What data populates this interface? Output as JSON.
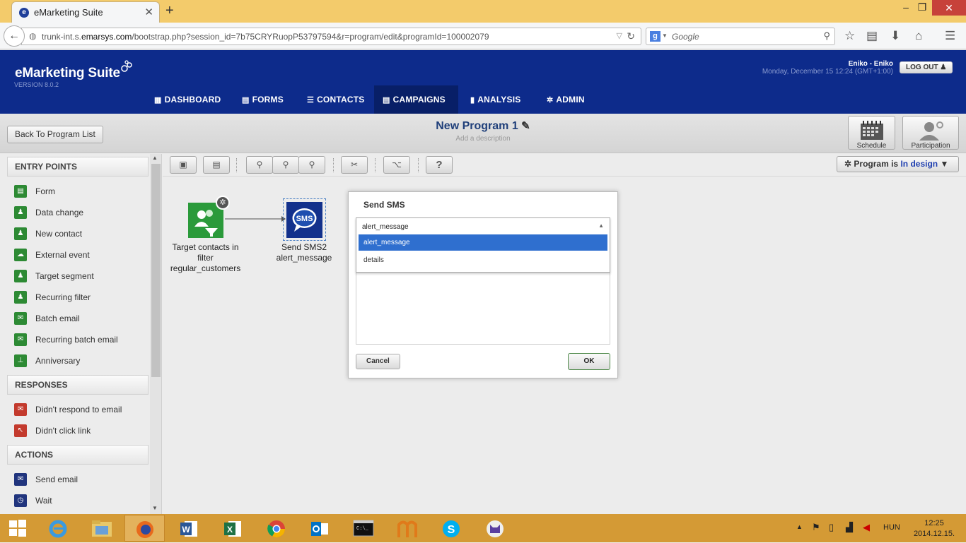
{
  "browser": {
    "tab_title": "eMarketing Suite",
    "url_prefix": "trunk-int.s.",
    "url_domain": "emarsys.com",
    "url_rest": "/bootstrap.php?session_id=7b75CRYRuopP53797594&r=program/edit&programId=100002079",
    "search_placeholder": "Google"
  },
  "app": {
    "logo": "eMarketing Suite",
    "version": "VERSION 8.0.2",
    "user": "Eniko - Eniko",
    "datetime": "Monday, December 15 12:24 (GMT+1:00)",
    "logout": "LOG OUT",
    "menu": [
      {
        "label": "DASHBOARD",
        "icon": "dashboard-icon"
      },
      {
        "label": "FORMS",
        "icon": "forms-icon"
      },
      {
        "label": "CONTACTS",
        "icon": "contacts-icon"
      },
      {
        "label": "CAMPAIGNS",
        "icon": "campaigns-icon",
        "active": true
      },
      {
        "label": "ANALYSIS",
        "icon": "analysis-icon"
      },
      {
        "label": "ADMIN",
        "icon": "gear-icon"
      }
    ]
  },
  "program": {
    "back_button": "Back To Program List",
    "title": "New Program 1",
    "description": "Add a description",
    "schedule": "Schedule",
    "participation": "Participation",
    "status_prefix": "Program is",
    "status_value": "In design"
  },
  "sidebar": {
    "sections": [
      {
        "title": "ENTRY POINTS",
        "items": [
          "Form",
          "Data change",
          "New contact",
          "External event",
          "Target segment",
          "Recurring filter",
          "Batch email",
          "Recurring batch email",
          "Anniversary"
        ]
      },
      {
        "title": "RESPONSES",
        "items": [
          "Didn't respond to email",
          "Didn't click link"
        ]
      },
      {
        "title": "ACTIONS",
        "items": [
          "Send email",
          "Wait"
        ]
      }
    ]
  },
  "canvas": {
    "node1": {
      "line1": "Target contacts in",
      "line2": "filter",
      "line3": "regular_customers"
    },
    "node2": {
      "line1": "Send SMS2",
      "line2": "alert_message",
      "icon_label": "SMS"
    }
  },
  "dialog": {
    "title": "Send SMS",
    "selected": "alert_message",
    "options": [
      "alert_message",
      "details"
    ],
    "cancel": "Cancel",
    "ok": "OK"
  },
  "taskbar": {
    "language": "HUN",
    "time": "12:25",
    "date": "2014.12.15."
  }
}
